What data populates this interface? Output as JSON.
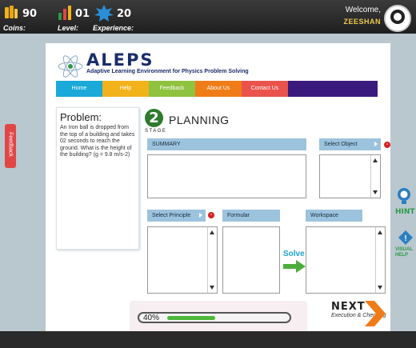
{
  "topbar": {
    "coins_value": "90",
    "coins_label": "Coins:",
    "level_value": "01",
    "level_label": "Level:",
    "experience_value": "20",
    "experience_label": "Experience:",
    "welcome_text": "Welcome,",
    "username": "ZEESHAN"
  },
  "logo": {
    "title": "ALEPS",
    "subtitle": "Adaptive Learning Environment for Physics Problem Solving"
  },
  "nav": {
    "items": [
      {
        "label": "Home",
        "color": "#1aa9d8"
      },
      {
        "label": "Help",
        "color": "#f2b21b"
      },
      {
        "label": "Feedback",
        "color": "#8fc23f"
      },
      {
        "label": "About Us",
        "color": "#f07c17"
      },
      {
        "label": "Contact Us",
        "color": "#e9534c"
      }
    ]
  },
  "problem": {
    "heading": "Problem:",
    "text": "An Iron ball is dropped from the top of a building and takes 02 seconds to reach the ground. What is the height of the building? (g = 9.8 m/s-2)"
  },
  "stage": {
    "number": "2",
    "label": "STAGE",
    "title": "PLANNING"
  },
  "summary": {
    "header": "SUMMARY"
  },
  "select_object": {
    "label": "Select Object"
  },
  "select_principle": {
    "label": "Select Principle"
  },
  "formular": {
    "header": "Formular"
  },
  "workspace": {
    "header": "Workspace"
  },
  "solve": {
    "label": "Solve"
  },
  "progress": {
    "text": "40%",
    "value": 40
  },
  "next": {
    "title": "NEXT",
    "subtitle": "Execution & Checking"
  },
  "feedback_tab": {
    "label": "Feedback"
  },
  "hint": {
    "label": "HINT"
  },
  "visual_help": {
    "label": "VISUAL HELP"
  },
  "colors": {
    "accent_green": "#2e7b2e",
    "nav_bg": "#3b1a7e",
    "header_blue": "#9cc3dd"
  }
}
